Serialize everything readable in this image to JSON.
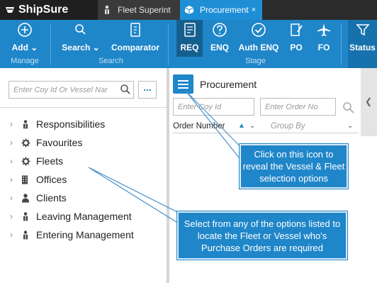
{
  "app": {
    "name": "ShipSure"
  },
  "tabs": [
    {
      "label": "Fleet Superint",
      "icon": "person-icon",
      "active": false
    },
    {
      "label": "Procurement",
      "icon": "box-icon",
      "active": true,
      "close": "×"
    }
  ],
  "ribbon": {
    "manage": {
      "add_label": "Add",
      "group": "Manage"
    },
    "search": {
      "search_label": "Search",
      "comparator_label": "Comparator",
      "group": "Search"
    },
    "stage": {
      "req": "REQ",
      "enq": "ENQ",
      "auth_enq": "Auth ENQ",
      "po": "PO",
      "fo": "FO",
      "group": "Stage"
    },
    "status_label": "Status"
  },
  "left_panel": {
    "search_placeholder": "Enter Coy Id Or Vessel Nar",
    "more_label": "...",
    "tree": [
      {
        "label": "Responsibilities",
        "icon": "person-icon"
      },
      {
        "label": "Favourites",
        "icon": "gear-icon"
      },
      {
        "label": "Fleets",
        "icon": "gear-icon"
      },
      {
        "label": "Offices",
        "icon": "building-icon"
      },
      {
        "label": "Clients",
        "icon": "person-icon"
      },
      {
        "label": "Leaving Management",
        "icon": "person-icon"
      },
      {
        "label": "Entering Management",
        "icon": "person-icon"
      }
    ]
  },
  "right_panel": {
    "title": "Procurement",
    "coy_placeholder": "Enter Coy Id",
    "order_placeholder": "Enter Order No",
    "sort_label": "Order Number",
    "group_placeholder": "Group By"
  },
  "callouts": {
    "icon_hint": "Click on this icon to reveal the Vessel & Fleet selection options",
    "options_hint": "Select from any of the options listed to locate the Fleet or Vessel who's Purchase Orders are required"
  },
  "colors": {
    "accent": "#1f86c9",
    "dark_bar": "#2b2b2b",
    "active_tab": "#1e8fd6"
  }
}
